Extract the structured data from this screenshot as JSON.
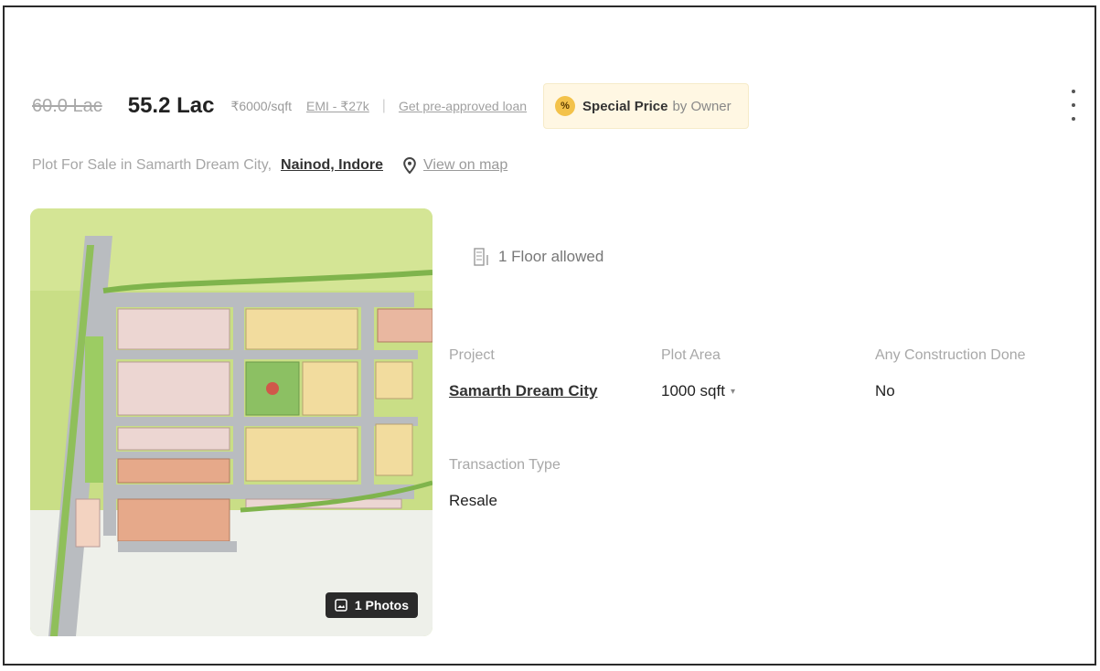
{
  "price": {
    "old": "60.0 Lac",
    "current": "55.2 Lac",
    "rate": "₹6000/sqft",
    "emi": "EMI - ₹27k",
    "separator": "|",
    "loan_link": "Get pre-approved loan"
  },
  "badge": {
    "icon_text": "%",
    "strong": "Special Price",
    "suffix": "by Owner"
  },
  "location": {
    "prefix": "Plot For Sale in Samarth Dream City,",
    "locality": "Nainod, Indore",
    "map_link": "View on map"
  },
  "photo": {
    "count_label": "1 Photos"
  },
  "details": {
    "floor": "1 Floor allowed",
    "project_label": "Project",
    "project_value": "Samarth Dream City",
    "area_label": "Plot Area",
    "area_value": "1000 sqft",
    "construction_label": "Any Construction Done",
    "construction_value": "No",
    "transaction_label": "Transaction Type",
    "transaction_value": "Resale"
  },
  "colors": {
    "badge_bg": "#fff7e3",
    "badge_icon": "#f3c24a",
    "photo_badge_bg": "#2a2a2a"
  }
}
